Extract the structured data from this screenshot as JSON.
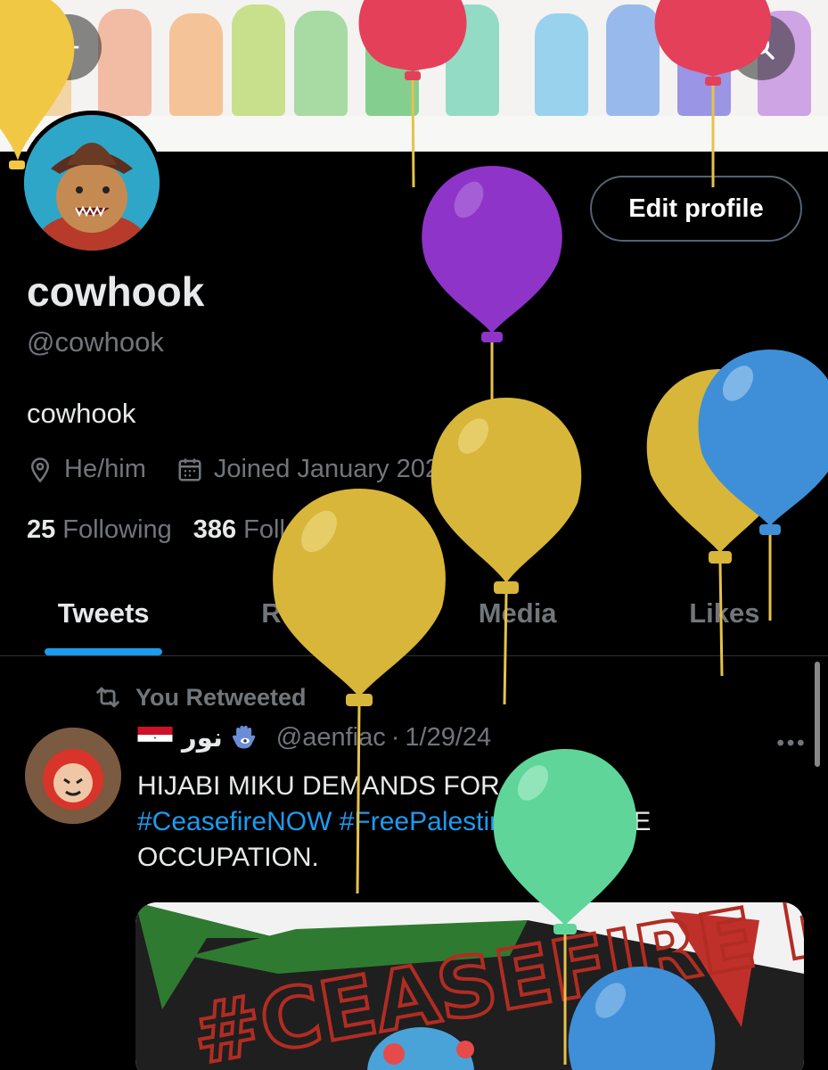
{
  "header": {
    "back_icon": "arrow-left-icon",
    "search_icon": "search-icon"
  },
  "profile": {
    "edit_button": "Edit profile",
    "display_name": "cowhook",
    "handle": "@cowhook",
    "bio": "cowhook",
    "pronouns": "He/him",
    "joined": "Joined January 2021",
    "following_count": "25",
    "following_label": "Following",
    "followers_count": "386",
    "followers_label": "Followers"
  },
  "tabs": [
    {
      "label": "Tweets",
      "active": true
    },
    {
      "label": "Replies",
      "active": false
    },
    {
      "label": "Media",
      "active": false
    },
    {
      "label": "Likes",
      "active": false
    }
  ],
  "tweet": {
    "retweet_label": "You Retweeted",
    "author_name": "نور",
    "author_handle": "@aenfiac",
    "separator": "·",
    "date": "1/29/24",
    "more_icon": "more-horizontal-icon",
    "text_plain_1": "HIJABI MIKU DEMANDS FOR A",
    "hashtag_1": "#CeasefireNOW",
    "hashtag_2": "#FreePalestine",
    "text_plain_2": ". END THE OCCUPATION.",
    "media_text": "#CEASEFIRE NOW"
  },
  "colors": {
    "background": "#000000",
    "accent": "#1d9bf0",
    "muted": "#71767b",
    "text": "#e7e9ea"
  },
  "balloons": [
    {
      "color": "#e4405a"
    },
    {
      "color": "#e4405a"
    },
    {
      "color": "#f0c844"
    },
    {
      "color": "#8e34c8"
    },
    {
      "color": "#d8b63a"
    },
    {
      "color": "#d8b63a"
    },
    {
      "color": "#d8b63a"
    },
    {
      "color": "#3f8fd8"
    },
    {
      "color": "#5fd59a"
    },
    {
      "color": "#3f8fd8"
    }
  ]
}
